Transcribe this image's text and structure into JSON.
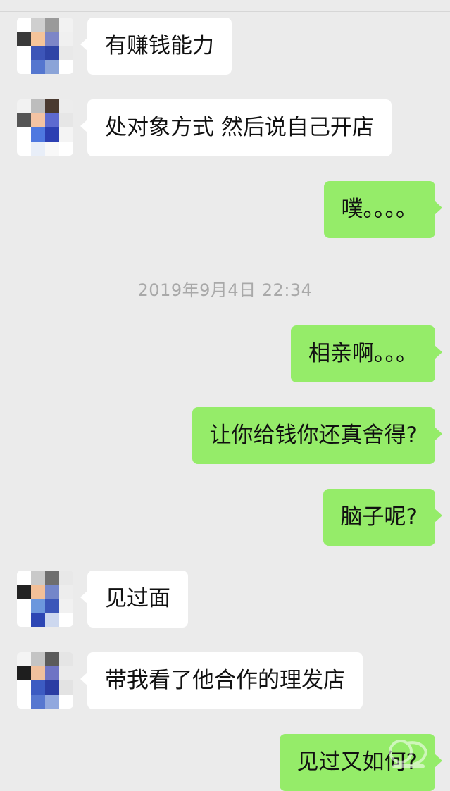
{
  "messages": [
    {
      "side": "received",
      "text": "有赚钱能力"
    },
    {
      "side": "received",
      "text": "处对象方式 然后说自己开店"
    },
    {
      "side": "sent",
      "text": "噗。。。。"
    },
    {
      "side": "timestamp",
      "text": "2019年9月4日 22:34"
    },
    {
      "side": "sent",
      "text": "相亲啊。。。"
    },
    {
      "side": "sent",
      "text": "让你给钱你还真舍得?"
    },
    {
      "side": "sent",
      "text": "脑子呢?"
    },
    {
      "side": "received",
      "text": "见过面"
    },
    {
      "side": "received",
      "text": "带我看了他合作的理发店"
    },
    {
      "side": "sent",
      "text": "见过又如何?"
    }
  ],
  "colors": {
    "background": "#ebebeb",
    "sent_bubble": "#95ec69",
    "received_bubble": "#ffffff",
    "timestamp_text": "#a9a9a9"
  },
  "icons": {
    "avatar": "pixelated-avatar-icon",
    "watermark": "site-watermark-logo"
  }
}
